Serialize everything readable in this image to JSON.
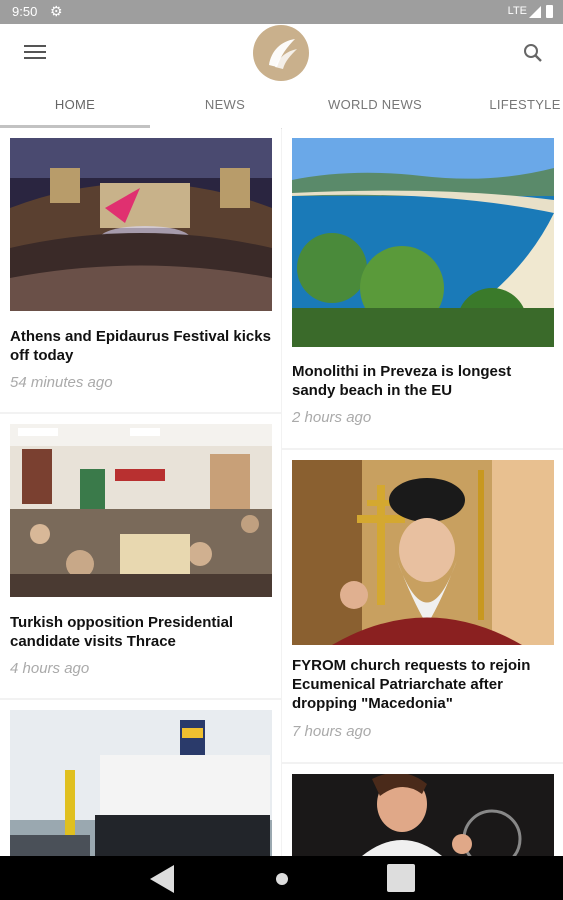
{
  "status_bar": {
    "time": "9:50",
    "network": "LTE"
  },
  "header": {
    "menu_icon": "hamburger-menu-icon",
    "logo": "feather-logo",
    "search_icon": "search-icon",
    "accent_color": "#c9b08c"
  },
  "tabs": [
    {
      "label": "HOME",
      "active": true
    },
    {
      "label": "NEWS",
      "active": false
    },
    {
      "label": "WORLD NEWS",
      "active": false
    },
    {
      "label": "LIFESTYLE",
      "active": false
    }
  ],
  "articles_left": [
    {
      "title": "Athens and Epidaurus Festival kicks off today",
      "time": "54 minutes ago",
      "image": "theater-festival-photo"
    },
    {
      "title": "Turkish opposition Presidential candidate visits Thrace",
      "time": "4 hours ago",
      "image": "meeting-hall-photo"
    },
    {
      "title": "",
      "time": "",
      "image": "cargo-ship-photo"
    }
  ],
  "articles_right": [
    {
      "title": "Monolithi in Preveza is longest sandy beach in the EU",
      "time": "2 hours ago",
      "image": "beach-photo"
    },
    {
      "title": "FYROM church requests to rejoin Ecumenical Patriarchate after dropping \"Macedonia\"",
      "time": "7 hours ago",
      "image": "patriarch-photo"
    },
    {
      "title": "",
      "time": "",
      "image": "tennis-player-photo"
    }
  ],
  "nav_bar": {
    "back": "back-icon",
    "home": "home-icon",
    "recents": "recents-icon"
  }
}
